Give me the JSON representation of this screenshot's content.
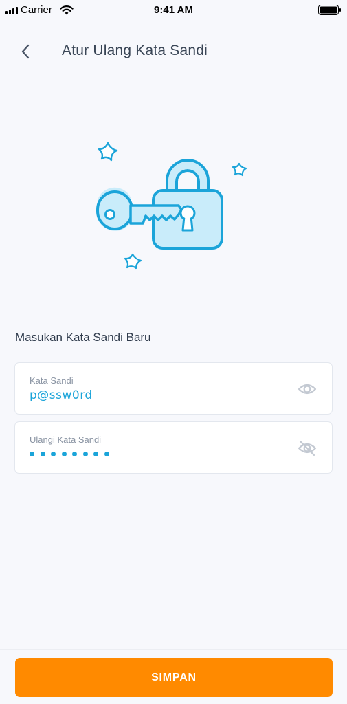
{
  "status_bar": {
    "carrier": "Carrier",
    "time": "9:41 AM"
  },
  "header": {
    "title": "Atur Ulang Kata Sandi",
    "back_icon": "chevron-left-icon"
  },
  "illustration": {
    "name": "key-and-padlock-illustration",
    "accent_color": "#1ba4d9",
    "fill_color": "#c9ecfa"
  },
  "form": {
    "section_title": "Masukan Kata Sandi Baru",
    "password": {
      "label": "Kata Sandi",
      "value": "p@ssw0rd",
      "visibility": "visible",
      "icon": "eye-icon"
    },
    "confirm_password": {
      "label": "Ulangi Kata Sandi",
      "value_masked": true,
      "visibility": "hidden",
      "icon": "eye-off-icon"
    }
  },
  "actions": {
    "save_label": "SIMPAN"
  },
  "colors": {
    "background": "#f7f8fc",
    "primary_button": "#ff8a00",
    "value_text": "#1ba4d9",
    "label_text": "#8a94a3"
  }
}
